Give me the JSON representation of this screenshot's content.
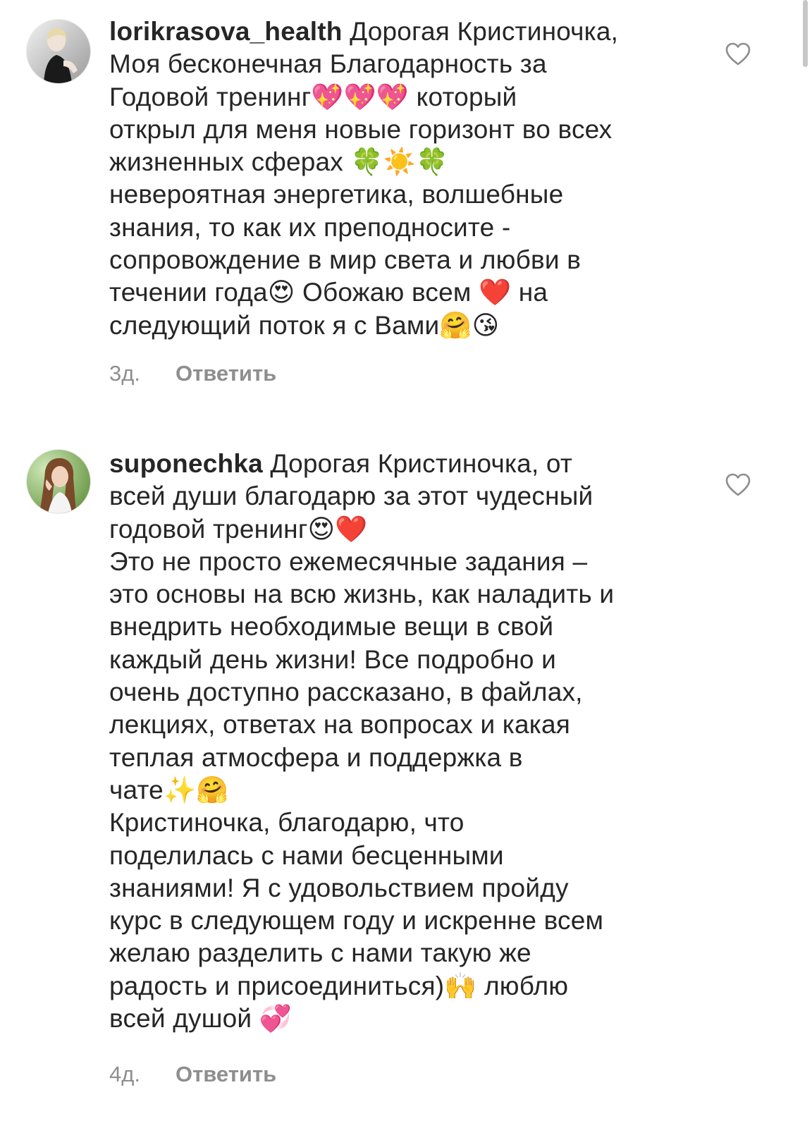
{
  "comments": [
    {
      "username": "lorikrasova_health",
      "lines": [
        "Дорогая Кристиночка,",
        "Моя бесконечная Благодарность за",
        "Годовой тренинг💖💖💖 который",
        "открыл для меня новые горизонт во всех",
        "жизненных сферах 🍀☀️🍀",
        "невероятная энергетика, волшебные",
        "знания, то как их преподносите -",
        "сопровождение в мир света и любви в",
        "течении года😍 Обожаю всем ❤️ на",
        "следующий поток я с Вами🤗😘"
      ],
      "time": "3д.",
      "reply_label": "Ответить",
      "avatar_icon": "avatar-photo-woman-dark"
    },
    {
      "username": "suponechka",
      "lines": [
        "Дорогая Кристиночка, от",
        "всей души благодарю за этот чудесный",
        "годовой тренинг😍❤️",
        "Это не просто ежемесячные задания –",
        "это основы на всю жизнь, как наладить и",
        "внедрить необходимые вещи в свой",
        "каждый день жизни! Все подробно и",
        "очень доступно рассказано, в файлах,",
        "лекциях, ответах на вопросах и какая",
        "теплая атмосфера и поддержка в",
        "чате✨🤗",
        "Кристиночка, благодарю, что",
        "поделилась с нами бесценными",
        "знаниями!  Я с удовольствием пройду",
        "курс в следующем году и искренне всем",
        "желаю разделить с нами такую же",
        "радость и присоединиться)🙌 люблю",
        "всей душой 💞"
      ],
      "time": "4д.",
      "reply_label": "Ответить",
      "avatar_icon": "avatar-photo-woman-green"
    }
  ],
  "colors": {
    "text": "#262626",
    "muted": "#8e8e8e",
    "heart_outline": "#8e8e8e"
  }
}
